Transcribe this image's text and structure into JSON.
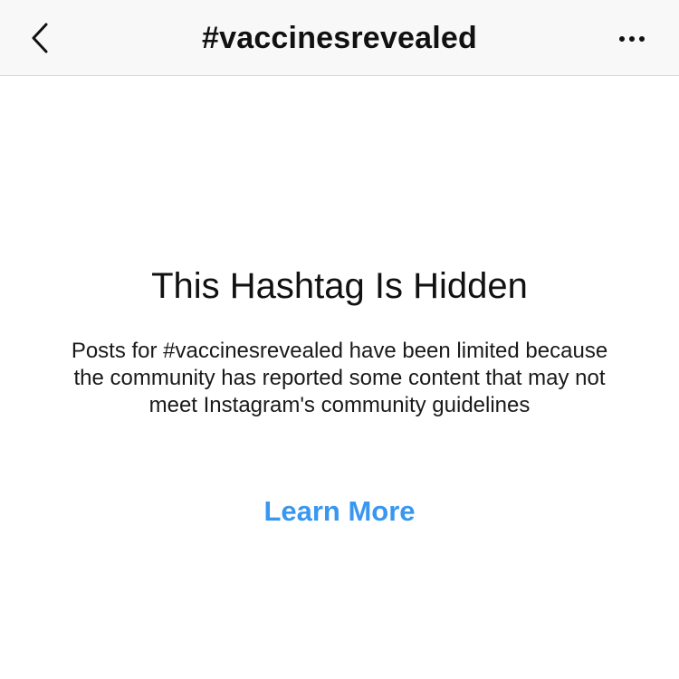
{
  "header": {
    "back_icon": "chevron-left-icon",
    "title": "#vaccinesrevealed",
    "more_icon": "more-horizontal-icon"
  },
  "main": {
    "heading": "This Hashtag Is Hidden",
    "message": "Posts for #vaccinesrevealed have been limited because the community has reported some content that may not meet Instagram's community guidelines",
    "learn_more_label": "Learn More"
  },
  "colors": {
    "nav_background": "#f8f8f8",
    "link": "#3897f0",
    "text": "#111111"
  }
}
